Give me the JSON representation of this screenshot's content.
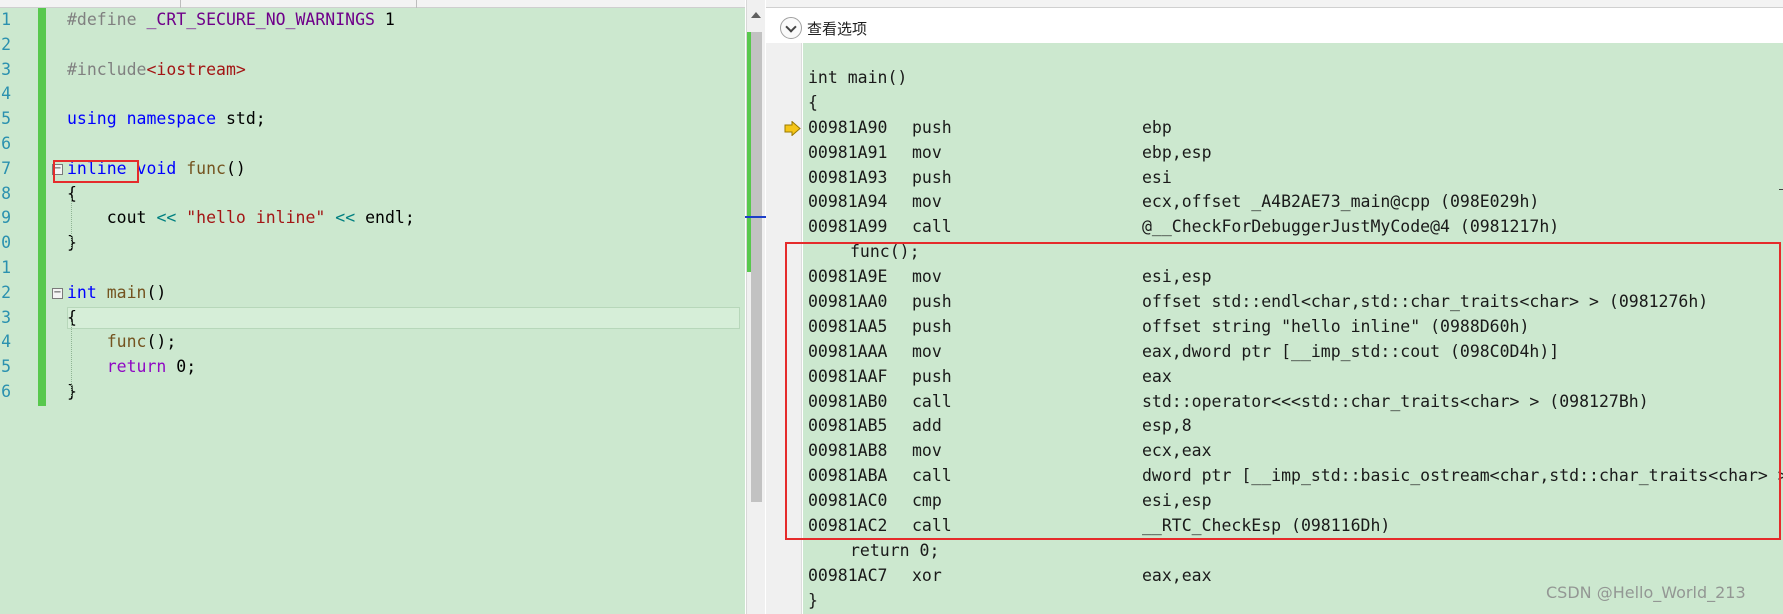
{
  "editor": {
    "line_numbers": [
      "1",
      "2",
      "3",
      "4",
      "5",
      "6",
      "7",
      "8",
      "9",
      "0",
      "1",
      "2",
      "3",
      "4",
      "5",
      "6"
    ],
    "code": {
      "l1_define": "#define",
      "l1_macro": "_CRT_SECURE_NO_WARNINGS",
      "l1_value": "1",
      "l3_include": "#include",
      "l3_header": "<iostream>",
      "l5_using": "using",
      "l5_namespace": "namespace",
      "l5_std": "std;",
      "l7_inline": "inline",
      "l7_void": "void",
      "l7_func": "func",
      "l7_parens": "()",
      "l8_brace": "{",
      "l9_cout": "cout",
      "l9_op1": "<<",
      "l9_string": "\"hello inline\"",
      "l9_op2": "<<",
      "l9_endl": "endl;",
      "l10_brace": "}",
      "l12_int": "int",
      "l12_main": "main",
      "l12_parens": "()",
      "l13_brace": "{",
      "l14_call": "func",
      "l14_rest": "();",
      "l15_return": "return",
      "l15_value": "0;",
      "l16_brace": "}"
    }
  },
  "disassembly": {
    "view_options_label": "查看选项",
    "header": "int main()",
    "open_brace": "{",
    "rows_before": [
      {
        "addr": "00981A90",
        "mnemonic": "push",
        "operands": "ebp"
      },
      {
        "addr": "00981A91",
        "mnemonic": "mov",
        "operands": "ebp,esp"
      },
      {
        "addr": "00981A93",
        "mnemonic": "push",
        "operands": "esi"
      },
      {
        "addr": "00981A94",
        "mnemonic": "mov",
        "operands": "ecx,offset _A4B2AE73_main@cpp (098E029h)"
      },
      {
        "addr": "00981A99",
        "mnemonic": "call",
        "operands": "@__CheckForDebuggerJustMyCode@4 (0981217h)"
      }
    ],
    "source_func_call": "func();",
    "rows_inline": [
      {
        "addr": "00981A9E",
        "mnemonic": "mov",
        "operands": "esi,esp"
      },
      {
        "addr": "00981AA0",
        "mnemonic": "push",
        "operands": "offset std::endl<char,std::char_traits<char> > (0981276h)"
      },
      {
        "addr": "00981AA5",
        "mnemonic": "push",
        "operands": "offset string \"hello inline\" (0988D60h)"
      },
      {
        "addr": "00981AAA",
        "mnemonic": "mov",
        "operands": "eax,dword ptr [__imp_std::cout (098C0D4h)]"
      },
      {
        "addr": "00981AAF",
        "mnemonic": "push",
        "operands": "eax"
      },
      {
        "addr": "00981AB0",
        "mnemonic": "call",
        "operands": "std::operator<<<std::char_traits<char> > (098127Bh)"
      },
      {
        "addr": "00981AB5",
        "mnemonic": "add",
        "operands": "esp,8"
      },
      {
        "addr": "00981AB8",
        "mnemonic": "mov",
        "operands": "ecx,eax"
      },
      {
        "addr": "00981ABA",
        "mnemonic": "call",
        "operands": "dword ptr [__imp_std::basic_ostream<char,std::char_traits<char> >::oper"
      },
      {
        "addr": "00981AC0",
        "mnemonic": "cmp",
        "operands": "esi,esp"
      },
      {
        "addr": "00981AC2",
        "mnemonic": "call",
        "operands": "__RTC_CheckEsp (098116Dh)"
      }
    ],
    "source_return": "return 0;",
    "rows_after": [
      {
        "addr": "00981AC7",
        "mnemonic": "xor",
        "operands": "eax,eax"
      }
    ],
    "close_brace": "}"
  },
  "watermark": "CSDN @Hello_World_213",
  "colors": {
    "editor_background": "#cce8cf",
    "keyword": "#0000ff",
    "string": "#a31515",
    "highlight_box": "#e52b2b",
    "change_bar": "#57c84d"
  }
}
